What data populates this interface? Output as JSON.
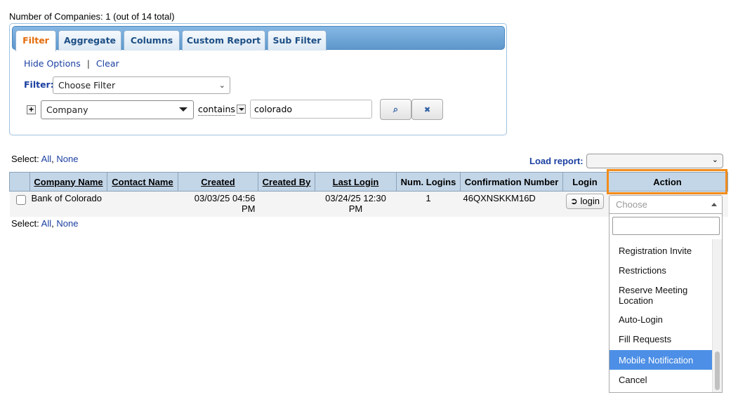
{
  "count": {
    "text": "Number of Companies: 1 (out of 14 total)"
  },
  "tabs": [
    {
      "label": "Filter",
      "active": true
    },
    {
      "label": "Aggregate"
    },
    {
      "label": "Columns"
    },
    {
      "label": "Custom Report"
    },
    {
      "label": "Sub Filter"
    }
  ],
  "filter_panel": {
    "hide_options": "Hide Options",
    "separator": "|",
    "clear": "Clear",
    "filter_label": "Filter:",
    "choose_filter": "Choose Filter",
    "plus": "+",
    "field_select": "Company",
    "operator": "contains",
    "value": "colorado",
    "search_icon": "search-icon",
    "clear_icon": "x-icon",
    "search_glyph": "⌕",
    "clear_glyph": "✖"
  },
  "select_row": {
    "label": "Select:",
    "all": "All",
    "comma": ",",
    "none": "None"
  },
  "load_report": {
    "label": "Load report:",
    "value": ""
  },
  "table": {
    "headers": [
      "",
      "Company Name",
      "Contact Name",
      "Created",
      "Created By",
      "Last Login",
      "Num. Logins",
      "Confirmation Number",
      "Login",
      "Action"
    ],
    "rows": [
      {
        "company": "Bank of Colorado",
        "contact": "",
        "created": "03/03/25 04:56 PM",
        "created_by": "",
        "last_login": "03/24/25 12:30 PM",
        "num_logins": "1",
        "confirmation": "46QXNSKKM16D",
        "login_label": "login",
        "login_glyph": "➲"
      }
    ]
  },
  "action_dropdown": {
    "placeholder": "Choose",
    "search_value": "",
    "options": [
      "Registration Invite",
      "Restrictions",
      "Reserve Meeting Location",
      "Auto-Login",
      "Fill Requests",
      "Mobile Notification",
      "Cancel"
    ],
    "highlighted": "Mobile Notification",
    "highlight_color": "#4d8fe6",
    "focus_color": "#f28c1c"
  }
}
